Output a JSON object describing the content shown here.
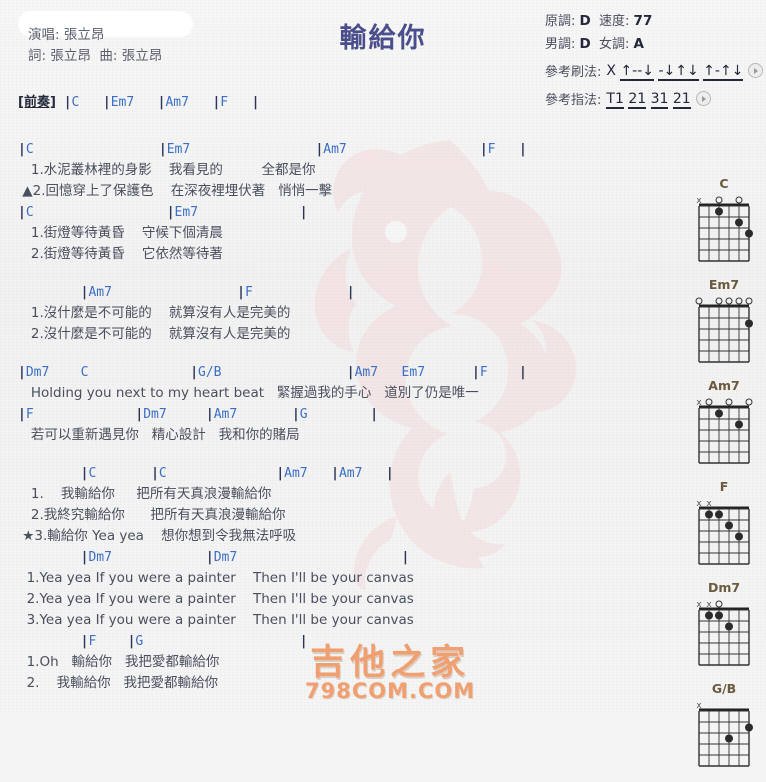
{
  "title": "輸給你",
  "credits": {
    "singer": "演唱: 張立昂",
    "writer": "詞: 張立昂  曲: 張立昂"
  },
  "meta": {
    "original_key_label": "原調:",
    "original_key": "D",
    "tempo_label": "速度:",
    "tempo": "77",
    "male_key_label": "男調:",
    "male_key": "D",
    "female_key_label": "女調:",
    "female_key": "A",
    "strum_label": "參考刷法:",
    "strum_lead": "X ",
    "strum_groups": [
      "↑--↓",
      "-↓↑↓",
      "↑-↑↓"
    ],
    "finger_label": "參考指法:",
    "finger_groups": [
      "T1",
      "21",
      "31",
      "21"
    ]
  },
  "body": [
    {
      "type": "intro",
      "tag": "[前奏]",
      "text": " |C   |Em7   |Am7   |F   |"
    },
    {
      "type": "spacer"
    },
    {
      "type": "chord",
      "text": "|C                |Em7                |Am7                 |F   |"
    },
    {
      "type": "lyric",
      "text": "   1.水泥叢林裡的身影    我看見的         全都是你"
    },
    {
      "type": "lyric",
      "text": " ▲2.回憶穿上了保護色    在深夜裡埋伏著   悄悄一擊"
    },
    {
      "type": "chord",
      "text": "|C                 |Em7             |"
    },
    {
      "type": "lyric",
      "text": "   1.街燈等待黃昏    守候下個清晨"
    },
    {
      "type": "lyric",
      "text": "   2.街燈等待黃昏    它依然等待著"
    },
    {
      "type": "spacer"
    },
    {
      "type": "chord",
      "text": "        |Am7                |F            |"
    },
    {
      "type": "lyric",
      "text": "   1.沒什麼是不可能的    就算沒有人是完美的"
    },
    {
      "type": "lyric",
      "text": "   2.沒什麼是不可能的    就算沒有人是完美的"
    },
    {
      "type": "spacer"
    },
    {
      "type": "chord",
      "text": "|Dm7    C             |G/B                |Am7   Em7      |F    |"
    },
    {
      "type": "lyric",
      "text": "   Holding you next to my heart beat   緊握過我的手心   道別了仍是唯一"
    },
    {
      "type": "chord",
      "text": "|F             |Dm7     |Am7       |G        |"
    },
    {
      "type": "lyric",
      "text": "   若可以重新遇見你   精心設計   我和你的賭局"
    },
    {
      "type": "spacer"
    },
    {
      "type": "chord",
      "text": "        |C       |C              |Am7   |Am7   |"
    },
    {
      "type": "lyric",
      "text": "   1.    我輸給你     把所有天真浪漫輸給你"
    },
    {
      "type": "lyric",
      "text": "   2.我終究輸給你      把所有天真浪漫輸給你"
    },
    {
      "type": "lyric",
      "text": " ★3.輸給你 Yea yea    想你想到令我無法呼吸"
    },
    {
      "type": "chord",
      "text": "        |Dm7            |Dm7                     |"
    },
    {
      "type": "lyric",
      "text": "  1.Yea yea If you were a painter    Then I'll be your canvas"
    },
    {
      "type": "lyric",
      "text": "  2.Yea yea If you were a painter    Then I'll be your canvas"
    },
    {
      "type": "lyric",
      "text": "  3.Yea yea If you were a painter    Then I'll be your canvas"
    },
    {
      "type": "chord",
      "text": "        |F    |G                    |"
    },
    {
      "type": "lyric",
      "text": "  1.Oh   輸給你   我把愛都輸給你"
    },
    {
      "type": "lyric",
      "text": "  2.    我輸給你   我把愛都輸給你"
    }
  ],
  "chords": [
    {
      "name": "C",
      "markers": [
        "x",
        "",
        "o",
        "",
        "o",
        ""
      ],
      "dots": [
        [
          5,
          3
        ],
        [
          4,
          2
        ],
        [
          2,
          1
        ]
      ]
    },
    {
      "name": "Em7",
      "markers": [
        "o",
        "",
        "o",
        "o",
        "o",
        "o"
      ],
      "dots": [
        [
          5,
          2
        ]
      ]
    },
    {
      "name": "Am7",
      "markers": [
        "x",
        "o",
        "",
        "o",
        "",
        "o"
      ],
      "dots": [
        [
          4,
          2
        ],
        [
          2,
          1
        ]
      ]
    },
    {
      "name": "F",
      "markers": [
        "x",
        "x",
        "",
        "",
        "",
        ""
      ],
      "dots": [
        [
          4,
          3
        ],
        [
          3,
          2
        ],
        [
          2,
          1
        ],
        [
          1,
          1
        ]
      ]
    },
    {
      "name": "Dm7",
      "markers": [
        "x",
        "x",
        "o",
        "",
        "",
        ""
      ],
      "dots": [
        [
          3,
          2
        ],
        [
          2,
          1
        ],
        [
          1,
          1
        ]
      ]
    },
    {
      "name": "G/B",
      "markers": [
        "x",
        "",
        "",
        "",
        "",
        ""
      ],
      "dots": [
        [
          5,
          2
        ],
        [
          3,
          3
        ]
      ]
    }
  ],
  "watermark": {
    "cn": "吉他之家",
    "en": "798COM.COM"
  }
}
